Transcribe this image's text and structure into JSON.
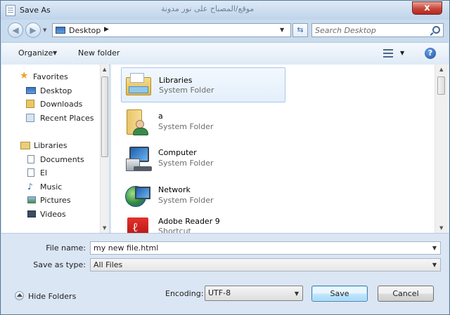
{
  "window": {
    "title": "Save As",
    "title_ghost": "ﻣﻮﻗﻊ/ﺍﻟﻤﺼﺒﺎﺡ ﻋﻠﻰ ﻧﻮﺭ ﻣﺪﻭﻧﺔ",
    "close_label": "x"
  },
  "address": {
    "location": "Desktop",
    "search_placeholder": "Search Desktop"
  },
  "toolbar": {
    "organize": "Organize",
    "new_folder": "New folder",
    "help": "?"
  },
  "sidebar": {
    "favorites": "Favorites",
    "favorites_items": [
      "Desktop",
      "Downloads",
      "Recent Places"
    ],
    "libraries": "Libraries",
    "libraries_items": [
      "Documents",
      "El",
      "Music",
      "Pictures",
      "Videos"
    ]
  },
  "files": [
    {
      "name": "Libraries",
      "type": "System Folder",
      "icon": "libraries-icon"
    },
    {
      "name": "a",
      "type": "System Folder",
      "icon": "user-folder-icon"
    },
    {
      "name": "Computer",
      "type": "System Folder",
      "icon": "computer-icon"
    },
    {
      "name": "Network",
      "type": "System Folder",
      "icon": "network-icon"
    },
    {
      "name": "Adobe Reader 9",
      "type": "Shortcut",
      "icon": "adobe-reader-icon"
    }
  ],
  "form": {
    "file_name_label": "File name:",
    "file_name_value": "my new file.html",
    "save_as_type_label": "Save as type:",
    "save_as_type_value": "All Files"
  },
  "footer": {
    "hide_folders": "Hide Folders",
    "encoding_label": "Encoding:",
    "encoding_value": "UTF-8",
    "save": "Save",
    "cancel": "Cancel"
  },
  "colors": {
    "chrome": "#c9dcef",
    "selection": "#e4effb",
    "accent": "#3c7fb1"
  }
}
